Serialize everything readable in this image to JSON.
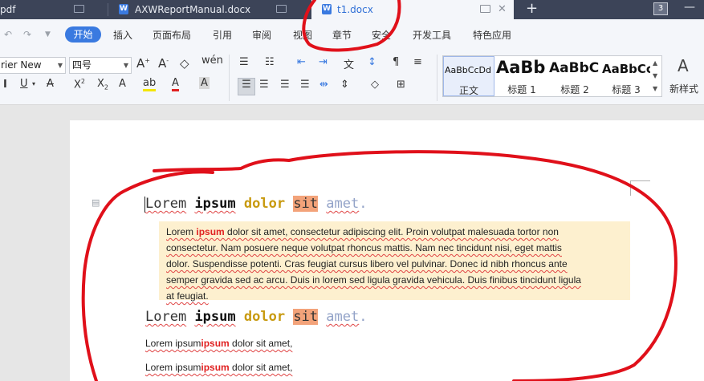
{
  "tabs": [
    {
      "label": "pdf",
      "active": false
    },
    {
      "label": "AXWReportManual.docx",
      "active": false
    },
    {
      "label": "t1.docx",
      "active": true
    }
  ],
  "tab_count_badge": "3",
  "menu": {
    "start": "开始",
    "items": [
      "插入",
      "页面布局",
      "引用",
      "审阅",
      "视图",
      "章节",
      "安全",
      "开发工具",
      "特色应用"
    ]
  },
  "ribbon": {
    "font_name": "rier New",
    "font_size": "四号",
    "styles": [
      {
        "sample": "AaBbCcDd",
        "name": "正文"
      },
      {
        "sample": "AaBb",
        "name": "标题 1"
      },
      {
        "sample": "AaBbC",
        "name": "标题 2"
      },
      {
        "sample": "AaBbCc",
        "name": "标题 3"
      }
    ],
    "new_style": "新样式"
  },
  "document": {
    "heading": {
      "w1": "Lorem",
      "w2": "ipsum",
      "w3": "dolor",
      "w4": "sit",
      "w5": "amet",
      "end": "."
    },
    "para_lines": [
      {
        "a": "Lorem ",
        "red": "ipsum",
        "b": " dolor sit amet, consectetur adipiscing elit. Proin volutpat malesuada tortor non"
      },
      {
        "a": "consectetur. Nam posuere neque volutpat rhoncus mattis. Nam nec tincidunt nisi, eget mattis"
      },
      {
        "a": "dolor. Suspendisse potenti. Cras feugiat cursus libero vel pulvinar. Donec id nibh rhoncus ante"
      },
      {
        "a": "semper gravida sed ac arcu. Duis in lorem sed ligula gravida vehicula. Duis finibus tincidunt ligula"
      },
      {
        "a": "at feugiat."
      }
    ],
    "line1": {
      "a": "Lorem ipsum",
      "red": "ipsum",
      "b": " dolor sit amet,"
    },
    "line2": {
      "a": "Lorem ipsum",
      "red": "ipsum",
      "b": " dolor sit amet,"
    }
  },
  "colors": {
    "tabbar": "#3c4458",
    "accent": "#3a7ae0",
    "annotation": "#e0101a",
    "highlight": "#f3a37a",
    "para_bg": "#fdf0cf"
  }
}
